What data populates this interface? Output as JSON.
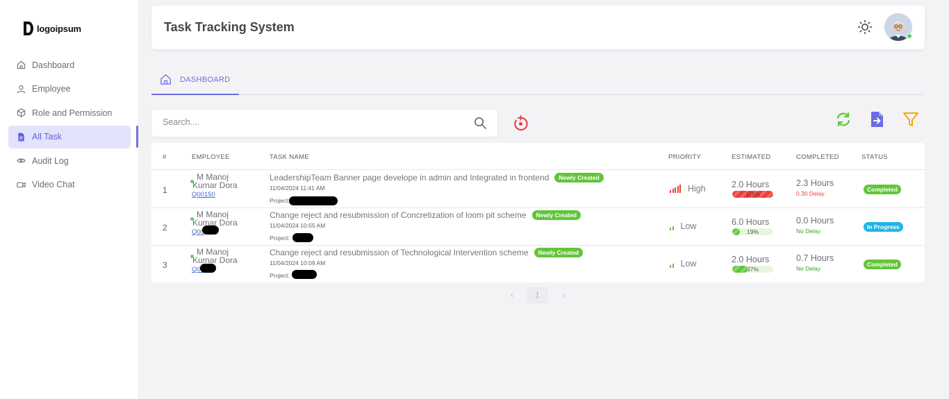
{
  "brand": {
    "logo_text": "logoipsum"
  },
  "sidebar": {
    "items": [
      {
        "label": "Dashboard",
        "icon": "home-icon",
        "active": false
      },
      {
        "label": "Employee",
        "icon": "user-icon",
        "active": false
      },
      {
        "label": "Role and Permission",
        "icon": "cube-icon",
        "active": false
      },
      {
        "label": "All Task",
        "icon": "document-icon",
        "active": true
      },
      {
        "label": "Audit Log",
        "icon": "eye-icon",
        "active": false
      },
      {
        "label": "Video Chat",
        "icon": "video-icon",
        "active": false
      }
    ]
  },
  "header": {
    "title": "Task Tracking System",
    "theme_icon": "sun-icon"
  },
  "tabs": [
    {
      "label": "DASHBOARD",
      "icon": "home-icon",
      "active": true
    }
  ],
  "search": {
    "placeholder": "Search...."
  },
  "toolbar": {
    "refresh_icon": "refresh-icon",
    "export_icon": "export-file-icon",
    "filter_icon": "filter-icon",
    "reset_icon": "reset-icon"
  },
  "table": {
    "columns": [
      "#",
      "EMPLOYEE",
      "TASK NAME",
      "PRIORITY",
      "ESTIMATED",
      "COMPLETED",
      "STATUS"
    ],
    "rows": [
      {
        "index": "1",
        "employee": "M Manoj Kumar Dora",
        "employee_code": "Q00150",
        "task": "LeadershipTeam Banner page develope in admin and Integrated in frontend",
        "badge": "Newly Created",
        "date": "11/04/2024 11:41 AM",
        "project_label": "Project:",
        "priority": "High",
        "estimated": "2.0 Hours",
        "progress_label": "115%",
        "progress_pct": 100,
        "completed": "2.3 Hours",
        "delay": "0.30 Delay",
        "status": "Completed"
      },
      {
        "index": "2",
        "employee": "M Manoj Kumar Dora",
        "employee_code": "Q00",
        "task": "Change reject and resubmission of Concretization of loom pit scheme",
        "badge": "Newly Created",
        "date": "11/04/2024 10:55 AM",
        "project_label": "Project:",
        "priority": "Low",
        "estimated": "6.0 Hours",
        "progress_label": "19%",
        "progress_pct": 19,
        "completed": "0.0 Hours",
        "delay": "No Delay",
        "status": "In Progress"
      },
      {
        "index": "3",
        "employee": "M Manoj Kumar Dora",
        "employee_code": "Q00",
        "task": "Change reject and resubmission of Technological Intervention scheme",
        "badge": "Newly Created",
        "date": "11/04/2024 10:09 AM",
        "project_label": "Project:",
        "priority": "Low",
        "estimated": "2.0 Hours",
        "progress_label": "37%",
        "progress_pct": 37,
        "completed": "0.7 Hours",
        "delay": "No Delay",
        "status": "Completed"
      }
    ]
  },
  "pagination": {
    "current": "1",
    "prev": "‹",
    "next": "›"
  },
  "colors": {
    "accent": "#6a6de4",
    "success": "#62c53a",
    "info": "#1fb6e8",
    "danger": "#e8413a",
    "warning": "#f6a800"
  }
}
